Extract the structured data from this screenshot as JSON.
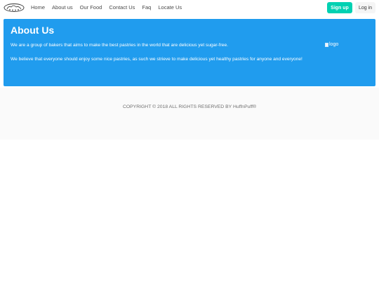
{
  "nav": {
    "links": [
      "Home",
      "About us",
      "Our Food",
      "Contact Us",
      "Faq",
      "Locate Us"
    ],
    "signup_label": "Sign up",
    "login_label": "Log in"
  },
  "hero": {
    "title": "About Us",
    "paragraph_1": "We are a group of bakers that aims to make the best pastries in the world that are delicious yet sugar-free.",
    "paragraph_2": "We believe that everyone should enjoy some nice pastries, as such we strieve to make delicious yet healthy pastries for anyone and everyone!",
    "image_alt": "logo"
  },
  "footer": {
    "copyright": "COPYRIGHT © 2018 ALL RIGHTS RESERVED BY HuffnPuff®"
  },
  "colors": {
    "hero_bg": "#209cee",
    "signup_bg": "#00d1b2",
    "footer_bg": "#fafafa"
  },
  "icons": {
    "brand": "chef-hat-logo-icon",
    "broken_image": "broken-image-icon"
  }
}
